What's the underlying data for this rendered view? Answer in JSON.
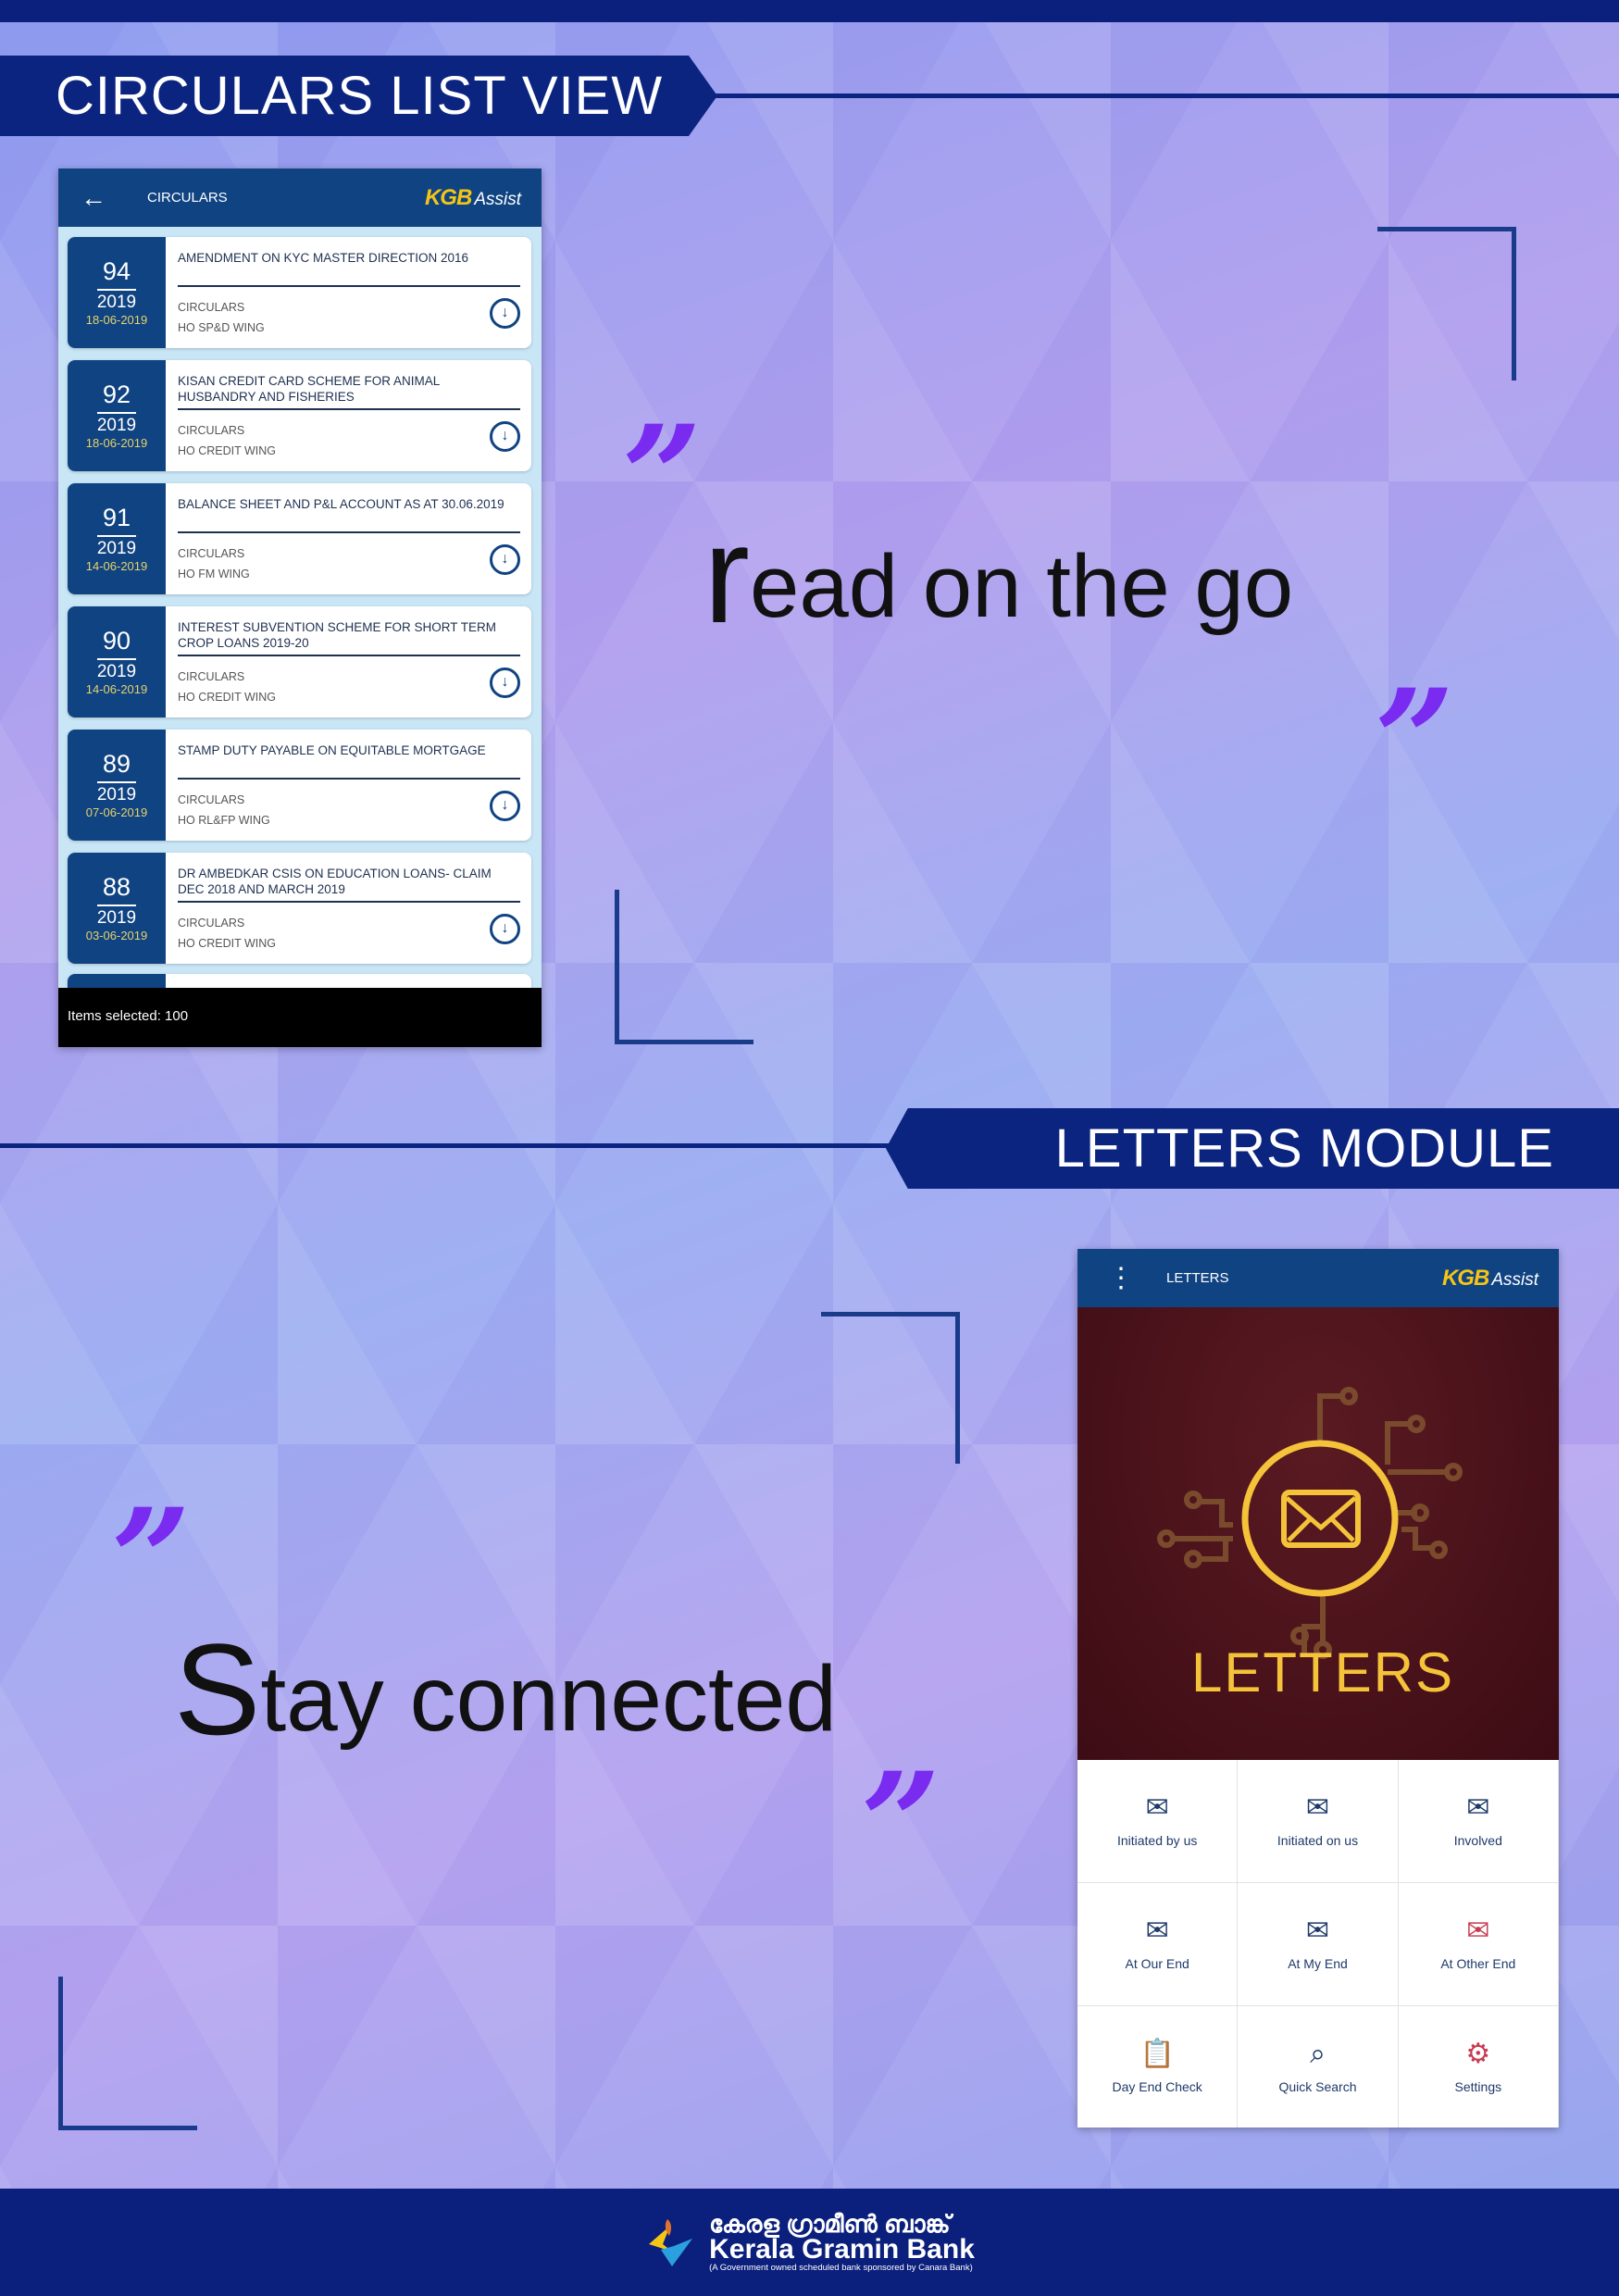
{
  "sections": {
    "circulars_title": "CIRCULARS LIST VIEW",
    "letters_title": "LETTERS MODULE"
  },
  "taglines": {
    "first": "read on the go",
    "second": "Stay connected",
    "quote_mark": "”"
  },
  "circulars_app": {
    "header_title": "CIRCULARS",
    "logo_kgb": "KGB",
    "logo_assist": "Assist",
    "items": [
      {
        "number": "94",
        "year": "2019",
        "date": "18-06-2019",
        "title": "AMENDMENT ON KYC MASTER DIRECTION 2016",
        "category": "CIRCULARS",
        "wing": "HO SP&D WING"
      },
      {
        "number": "92",
        "year": "2019",
        "date": "18-06-2019",
        "title": "KISAN CREDIT CARD SCHEME FOR ANIMAL HUSBANDRY AND FISHERIES",
        "category": "CIRCULARS",
        "wing": "HO CREDIT WING"
      },
      {
        "number": "91",
        "year": "2019",
        "date": "14-06-2019",
        "title": "BALANCE SHEET AND P&L ACCOUNT AS AT 30.06.2019",
        "category": "CIRCULARS",
        "wing": "HO FM WING"
      },
      {
        "number": "90",
        "year": "2019",
        "date": "14-06-2019",
        "title": "INTEREST SUBVENTION SCHEME FOR SHORT TERM CROP LOANS 2019-20",
        "category": "CIRCULARS",
        "wing": "HO CREDIT WING"
      },
      {
        "number": "89",
        "year": "2019",
        "date": "07-06-2019",
        "title": "STAMP DUTY PAYABLE ON EQUITABLE MORTGAGE",
        "category": "CIRCULARS",
        "wing": "HO RL&FP WING"
      },
      {
        "number": "88",
        "year": "2019",
        "date": "03-06-2019",
        "title": "DR AMBEDKAR CSIS ON EDUCATION LOANS- CLAIM DEC 2018 AND MARCH 2019",
        "category": "CIRCULARS",
        "wing": "HO CREDIT WING"
      }
    ],
    "footer": "Items selected: 100"
  },
  "letters_app": {
    "header_title": "LETTERS",
    "logo_kgb": "KGB",
    "logo_assist": "Assist",
    "hero_title": "LETTERS",
    "menu": [
      {
        "label": "Initiated by us",
        "icon": "envelope-upload-icon"
      },
      {
        "label": "Initiated on us",
        "icon": "envelope-download-icon"
      },
      {
        "label": "Involved",
        "icon": "envelope-user-icon"
      },
      {
        "label": "At Our End",
        "icon": "envelope-hand-icon"
      },
      {
        "label": "At My End",
        "icon": "envelope-document-icon"
      },
      {
        "label": "At Other End",
        "icon": "envelope-pen-icon"
      },
      {
        "label": "Day End Check",
        "icon": "clipboard-checklist-icon"
      },
      {
        "label": "Quick Search",
        "icon": "search-icon"
      },
      {
        "label": "Settings",
        "icon": "gear-icon"
      }
    ]
  },
  "bank": {
    "name_malayalam": "കേരള ഗ്രാമീൺ ബാങ്ക്",
    "name": "Kerala Gramin Bank",
    "tagline": "(A Government owned scheduled bank sponsored by Canara Bank)"
  },
  "colors": {
    "navy": "#0b1f7c",
    "accent_purple": "#7a2bf0",
    "app_blue": "#104382",
    "gold": "#f5c33a",
    "maroon": "#3d0c14"
  }
}
